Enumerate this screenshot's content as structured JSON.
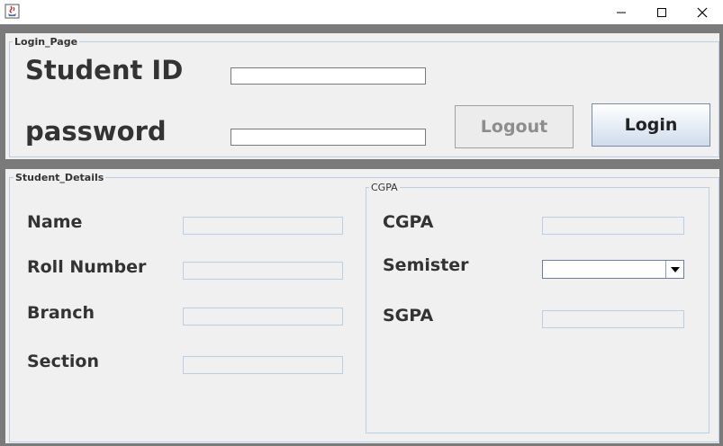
{
  "window": {
    "minimize_glyph": "—",
    "maximize_glyph": "☐",
    "close_glyph": "✕"
  },
  "login_panel": {
    "title": "Login_Page",
    "student_id_label": "Student ID",
    "password_label": "password",
    "student_id_value": "",
    "password_value": "",
    "logout_label": "Logout",
    "login_label": "Login"
  },
  "details_panel": {
    "title": "Student_Details",
    "name_label": "Name",
    "roll_label": "Roll Number",
    "branch_label": "Branch",
    "section_label": "Section",
    "name_value": "",
    "roll_value": "",
    "branch_value": "",
    "section_value": ""
  },
  "cgpa_panel": {
    "title": "CGPA",
    "cgpa_label": "CGPA",
    "semester_label": "Semister",
    "sgpa_label": "SGPA",
    "semester_selected": "",
    "cgpa_value": "",
    "sgpa_value": ""
  },
  "colors": {
    "frame": "#7a7a7a",
    "panel_bg": "#f0f0f0",
    "group_border": "#b8cfe5",
    "label_text": "#333333",
    "disabled_text": "#8d8d8d"
  },
  "icons": [
    "java-cup-icon",
    "minimize-icon",
    "maximize-icon",
    "close-icon",
    "chevron-down-icon"
  ]
}
